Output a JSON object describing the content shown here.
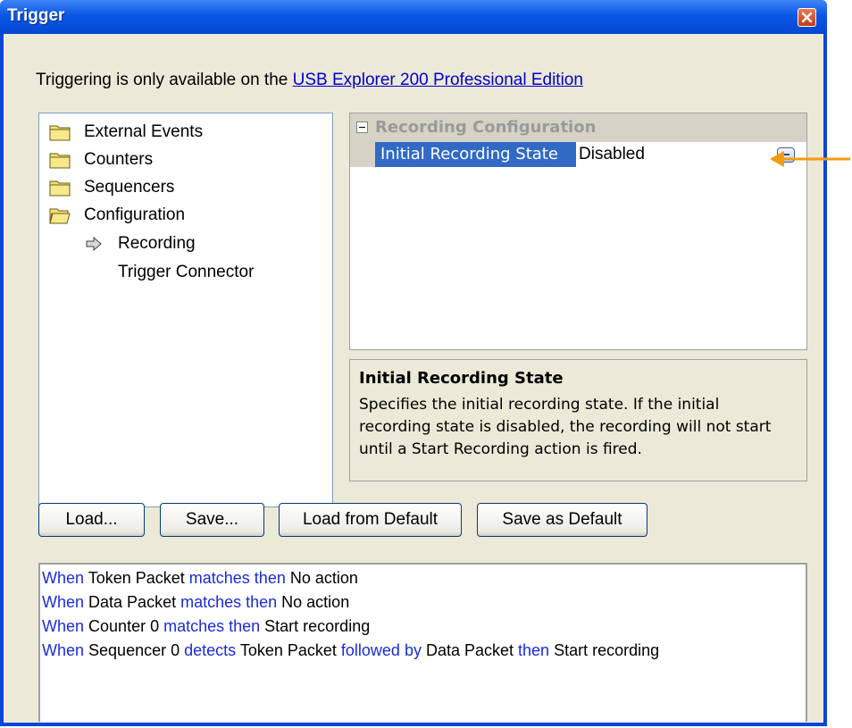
{
  "window": {
    "title": "Trigger"
  },
  "notice": {
    "text": "Triggering is only available on the ",
    "link": "USB Explorer 200 Professional Edition"
  },
  "tree": {
    "items": [
      {
        "label": "External Events",
        "icon": "folder-icon"
      },
      {
        "label": "Counters",
        "icon": "folder-icon"
      },
      {
        "label": "Sequencers",
        "icon": "folder-icon"
      },
      {
        "label": "Configuration",
        "icon": "folder-open-icon"
      },
      {
        "label": "Recording",
        "icon": "arrow-right-icon",
        "selected": true
      },
      {
        "label": "Trigger Connector"
      }
    ]
  },
  "property_grid": {
    "category": "Recording Configuration",
    "property_name": "Initial Recording State",
    "property_value": "Disabled"
  },
  "description": {
    "title": "Initial Recording State",
    "text": "Specifies the initial recording state. If the initial recording state is disabled, the recording will not start until a Start Recording action is fired."
  },
  "buttons": {
    "load": "Load...",
    "save": "Save...",
    "load_default": "Load from Default",
    "save_default": "Save as Default"
  },
  "rules": [
    [
      "When",
      " Token Packet ",
      "matches then",
      " No action"
    ],
    [
      "When",
      " Data Packet ",
      "matches then",
      " No action"
    ],
    [
      "When",
      " Counter 0 ",
      "matches then",
      " Start recording"
    ],
    [
      "When",
      " Sequencer 0 ",
      "detects",
      " Token Packet ",
      "followed by",
      " Data Packet ",
      "then",
      " Start recording"
    ]
  ],
  "colors": {
    "keyword": "#1a2bd9",
    "annotation_arrow": "#f39c12",
    "selection": "#316ac5"
  }
}
